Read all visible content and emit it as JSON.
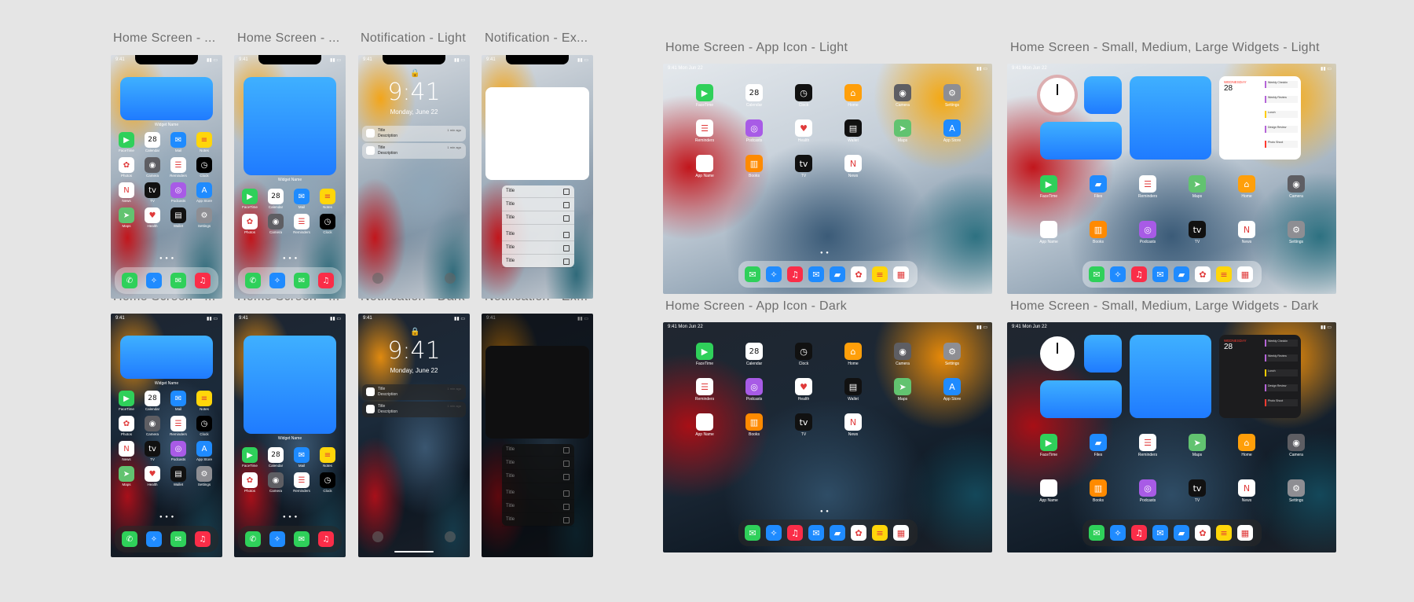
{
  "frames": {
    "phone_labels": [
      "Home Screen - ...",
      "Home Screen - ...",
      "Notification - Light",
      "Notification - Ex..."
    ],
    "phone_labels_row2": [
      "Home Screen - ...",
      "Home Screen - ...",
      "Notification - Dark",
      "Notification - Ex..."
    ],
    "ipad_labels": [
      "Home Screen - App Icon - Light",
      "Home Screen - Small, Medium, Large Widgets - Light",
      "Home Screen - App Icon - Dark",
      "Home Screen - Small, Medium, Large Widgets - Dark"
    ]
  },
  "status": {
    "time": "9:41",
    "ipad_time": "9:41  Mon Jun 22"
  },
  "widget": {
    "name": "Widget Name"
  },
  "lock": {
    "time": "9:41",
    "date": "Monday, June 22"
  },
  "notification": {
    "title": "Title",
    "description": "Description",
    "time": "1 min ago"
  },
  "menu": {
    "items": [
      "Title",
      "Title",
      "Title",
      "Title",
      "Title",
      "Title"
    ]
  },
  "calendar_icon": {
    "day": "MON",
    "date": "28"
  },
  "calendar_widget": {
    "weekday": "WEDNESDAY",
    "date": "28",
    "events": [
      "Weekly Checkin",
      "Weekly Review",
      "Lunch",
      "Design Review",
      "Photo Shoot"
    ]
  },
  "phone_apps": [
    {
      "label": "FaceTime",
      "icon": "facetime-icon",
      "color": "#2fd05a"
    },
    {
      "label": "Calendar",
      "icon": "calendar-icon",
      "color": "#ffffff"
    },
    {
      "label": "Mail",
      "icon": "mail-icon",
      "color": "#1e8bff"
    },
    {
      "label": "Notes",
      "icon": "notes-icon",
      "color": "#ffd60a"
    },
    {
      "label": "Photos",
      "icon": "photos-icon",
      "color": "#ffffff"
    },
    {
      "label": "Camera",
      "icon": "camera-icon",
      "color": "#5e5e63"
    },
    {
      "label": "Reminders",
      "icon": "reminders-icon",
      "color": "#ffffff"
    },
    {
      "label": "Clock",
      "icon": "clock-icon",
      "color": "#000000"
    },
    {
      "label": "News",
      "icon": "news-icon",
      "color": "#ffffff"
    },
    {
      "label": "TV",
      "icon": "tv-icon",
      "color": "#111111"
    },
    {
      "label": "Podcasts",
      "icon": "podcasts-icon",
      "color": "#a85be6"
    },
    {
      "label": "App Store",
      "icon": "app-store-icon",
      "color": "#1f8bff"
    },
    {
      "label": "Maps",
      "icon": "maps-icon",
      "color": "#62c370"
    },
    {
      "label": "Health",
      "icon": "health-icon",
      "color": "#ffffff"
    },
    {
      "label": "Wallet",
      "icon": "wallet-icon",
      "color": "#111111"
    },
    {
      "label": "Settings",
      "icon": "settings-icon",
      "color": "#8e8e93"
    }
  ],
  "phone_dock": [
    {
      "icon": "phone-icon",
      "color": "#2fd05a"
    },
    {
      "icon": "safari-icon",
      "color": "#1f8bff"
    },
    {
      "icon": "messages-icon",
      "color": "#2fd05a"
    },
    {
      "icon": "music-icon",
      "color": "#fa2d48"
    }
  ],
  "ipad_apps": [
    {
      "label": "FaceTime",
      "icon": "facetime-icon",
      "color": "#2fd05a"
    },
    {
      "label": "Calendar",
      "icon": "calendar-icon",
      "color": "#ffffff"
    },
    {
      "label": "Clock",
      "icon": "clock-icon",
      "color": "#111111"
    },
    {
      "label": "Home",
      "icon": "home-icon",
      "color": "#ff9f0a"
    },
    {
      "label": "Camera",
      "icon": "camera-icon",
      "color": "#5e5e63"
    },
    {
      "label": "Settings",
      "icon": "settings-icon",
      "color": "#8e8e93"
    },
    {
      "label": "Reminders",
      "icon": "reminders-icon",
      "color": "#ffffff"
    },
    {
      "label": "Podcasts",
      "icon": "podcasts-icon",
      "color": "#a85be6"
    },
    {
      "label": "Health",
      "icon": "health-icon",
      "color": "#ffffff"
    },
    {
      "label": "Wallet",
      "icon": "wallet-icon",
      "color": "#111111"
    },
    {
      "label": "Maps",
      "icon": "maps-icon",
      "color": "#62c370"
    },
    {
      "label": "App Store",
      "icon": "app-store-icon",
      "color": "#1f8bff"
    },
    {
      "label": "App Name",
      "icon": "app-icon",
      "color": "#ffffff"
    },
    {
      "label": "Books",
      "icon": "books-icon",
      "color": "#ff8a00"
    },
    {
      "label": "TV",
      "icon": "tv-icon",
      "color": "#111111"
    },
    {
      "label": "News",
      "icon": "news-icon",
      "color": "#ffffff"
    }
  ],
  "ipad_widget_apps": [
    {
      "label": "FaceTime",
      "icon": "facetime-icon",
      "color": "#2fd05a"
    },
    {
      "label": "Files",
      "icon": "files-icon",
      "color": "#1f8bff"
    },
    {
      "label": "Reminders",
      "icon": "reminders-icon",
      "color": "#ffffff"
    },
    {
      "label": "Maps",
      "icon": "maps-icon",
      "color": "#62c370"
    },
    {
      "label": "Home",
      "icon": "home-icon",
      "color": "#ff9f0a"
    },
    {
      "label": "Camera",
      "icon": "camera-icon",
      "color": "#5e5e63"
    },
    {
      "label": "App Name",
      "icon": "app-icon",
      "color": "#ffffff"
    },
    {
      "label": "Books",
      "icon": "books-icon",
      "color": "#ff8a00"
    },
    {
      "label": "Podcasts",
      "icon": "podcasts-icon",
      "color": "#a85be6"
    },
    {
      "label": "TV",
      "icon": "tv-icon",
      "color": "#111111"
    },
    {
      "label": "News",
      "icon": "news-icon",
      "color": "#ffffff"
    },
    {
      "label": "Settings",
      "icon": "settings-icon",
      "color": "#8e8e93"
    }
  ],
  "ipad_dock": [
    {
      "icon": "messages-icon",
      "color": "#2fd05a"
    },
    {
      "icon": "safari-icon",
      "color": "#1f8bff"
    },
    {
      "icon": "music-icon",
      "color": "#fa2d48"
    },
    {
      "icon": "mail-icon",
      "color": "#1e8bff"
    },
    {
      "icon": "files-icon",
      "color": "#1f8bff"
    },
    {
      "icon": "photos-icon",
      "color": "#ffffff"
    },
    {
      "icon": "notes-icon",
      "color": "#ffd60a"
    },
    {
      "icon": "app-library-icon",
      "color": "#ffffff"
    }
  ]
}
